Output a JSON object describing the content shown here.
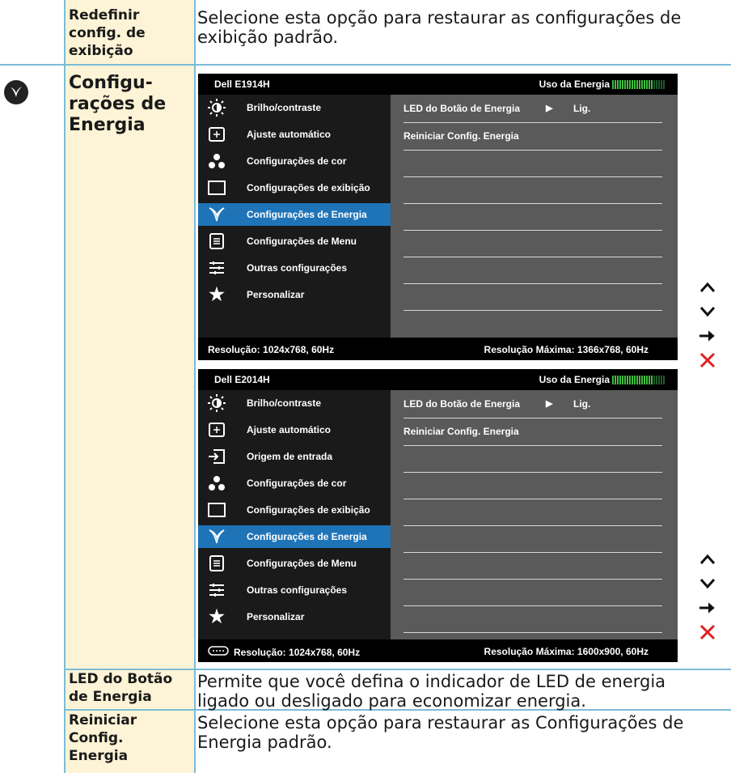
{
  "rows": {
    "reset_display": {
      "label": "Redefinir config. de exibição",
      "description": "Selecione esta opção para restaurar as configurações de exibição padrão."
    },
    "power_settings": {
      "label": "Configu-rações de Energia",
      "icon": "leaf-icon"
    },
    "power_button_led": {
      "label": "LED do Botão de Energia",
      "description": "Permite que você defina o indicador de LED de energia ligado ou desligado para economizar energia."
    },
    "reset_power": {
      "label": "Reiniciar Config. Energia",
      "description": "Selecione esta opção para restaurar as Configurações de Energia padrão."
    }
  },
  "osd1": {
    "model": "Dell E1914H",
    "energy_label": "Uso da Energia",
    "menu": [
      {
        "label": "Brilho/contraste",
        "icon": "brightness-icon"
      },
      {
        "label": "Ajuste automático",
        "icon": "auto-adjust-icon"
      },
      {
        "label": "Configurações de cor",
        "icon": "color-icon"
      },
      {
        "label": "Configurações de exibição",
        "icon": "display-icon"
      },
      {
        "label": "Configurações de Energia",
        "icon": "leaf-icon",
        "selected": true
      },
      {
        "label": "Configurações de Menu",
        "icon": "menu-icon"
      },
      {
        "label": "Outras configurações",
        "icon": "other-settings-icon"
      },
      {
        "label": "Personalizar",
        "icon": "star-icon"
      }
    ],
    "submenu": {
      "led_label": "LED do Botão de Energia",
      "led_value": "Lig.",
      "reset_label": "Reiniciar Config. Energia"
    },
    "resolution": "Resolução: 1024x768, 60Hz",
    "max_resolution": "Resolução Máxima: 1366x768, 60Hz"
  },
  "osd2": {
    "model": "Dell E2014H",
    "energy_label": "Uso da Energia",
    "menu": [
      {
        "label": "Brilho/contraste",
        "icon": "brightness-icon"
      },
      {
        "label": "Ajuste automático",
        "icon": "auto-adjust-icon"
      },
      {
        "label": "Origem de entrada",
        "icon": "input-source-icon"
      },
      {
        "label": "Configurações de cor",
        "icon": "color-icon"
      },
      {
        "label": "Configurações de exibição",
        "icon": "display-icon"
      },
      {
        "label": "Configurações de Energia",
        "icon": "leaf-icon",
        "selected": true
      },
      {
        "label": "Configurações de Menu",
        "icon": "menu-icon"
      },
      {
        "label": "Outras configurações",
        "icon": "other-settings-icon"
      },
      {
        "label": "Personalizar",
        "icon": "star-icon"
      }
    ],
    "submenu": {
      "led_label": "LED do Botão de Energia",
      "led_value": "Lig.",
      "reset_label": "Reiniciar Config. Energia"
    },
    "resolution": "Resolução: 1024x768, 60Hz",
    "max_resolution": "Resolução Máxima: 1600x900, 60Hz"
  },
  "nav_buttons": [
    "up-arrow-icon",
    "down-arrow-icon",
    "right-arrow-icon",
    "close-icon"
  ],
  "colors": {
    "label_cell_bg": "#fdf3d6",
    "grid_line": "#7bbcd8",
    "selected_menu": "#1f74b8",
    "energy_meter": "#3fbf3f",
    "close_red": "#e02020"
  }
}
